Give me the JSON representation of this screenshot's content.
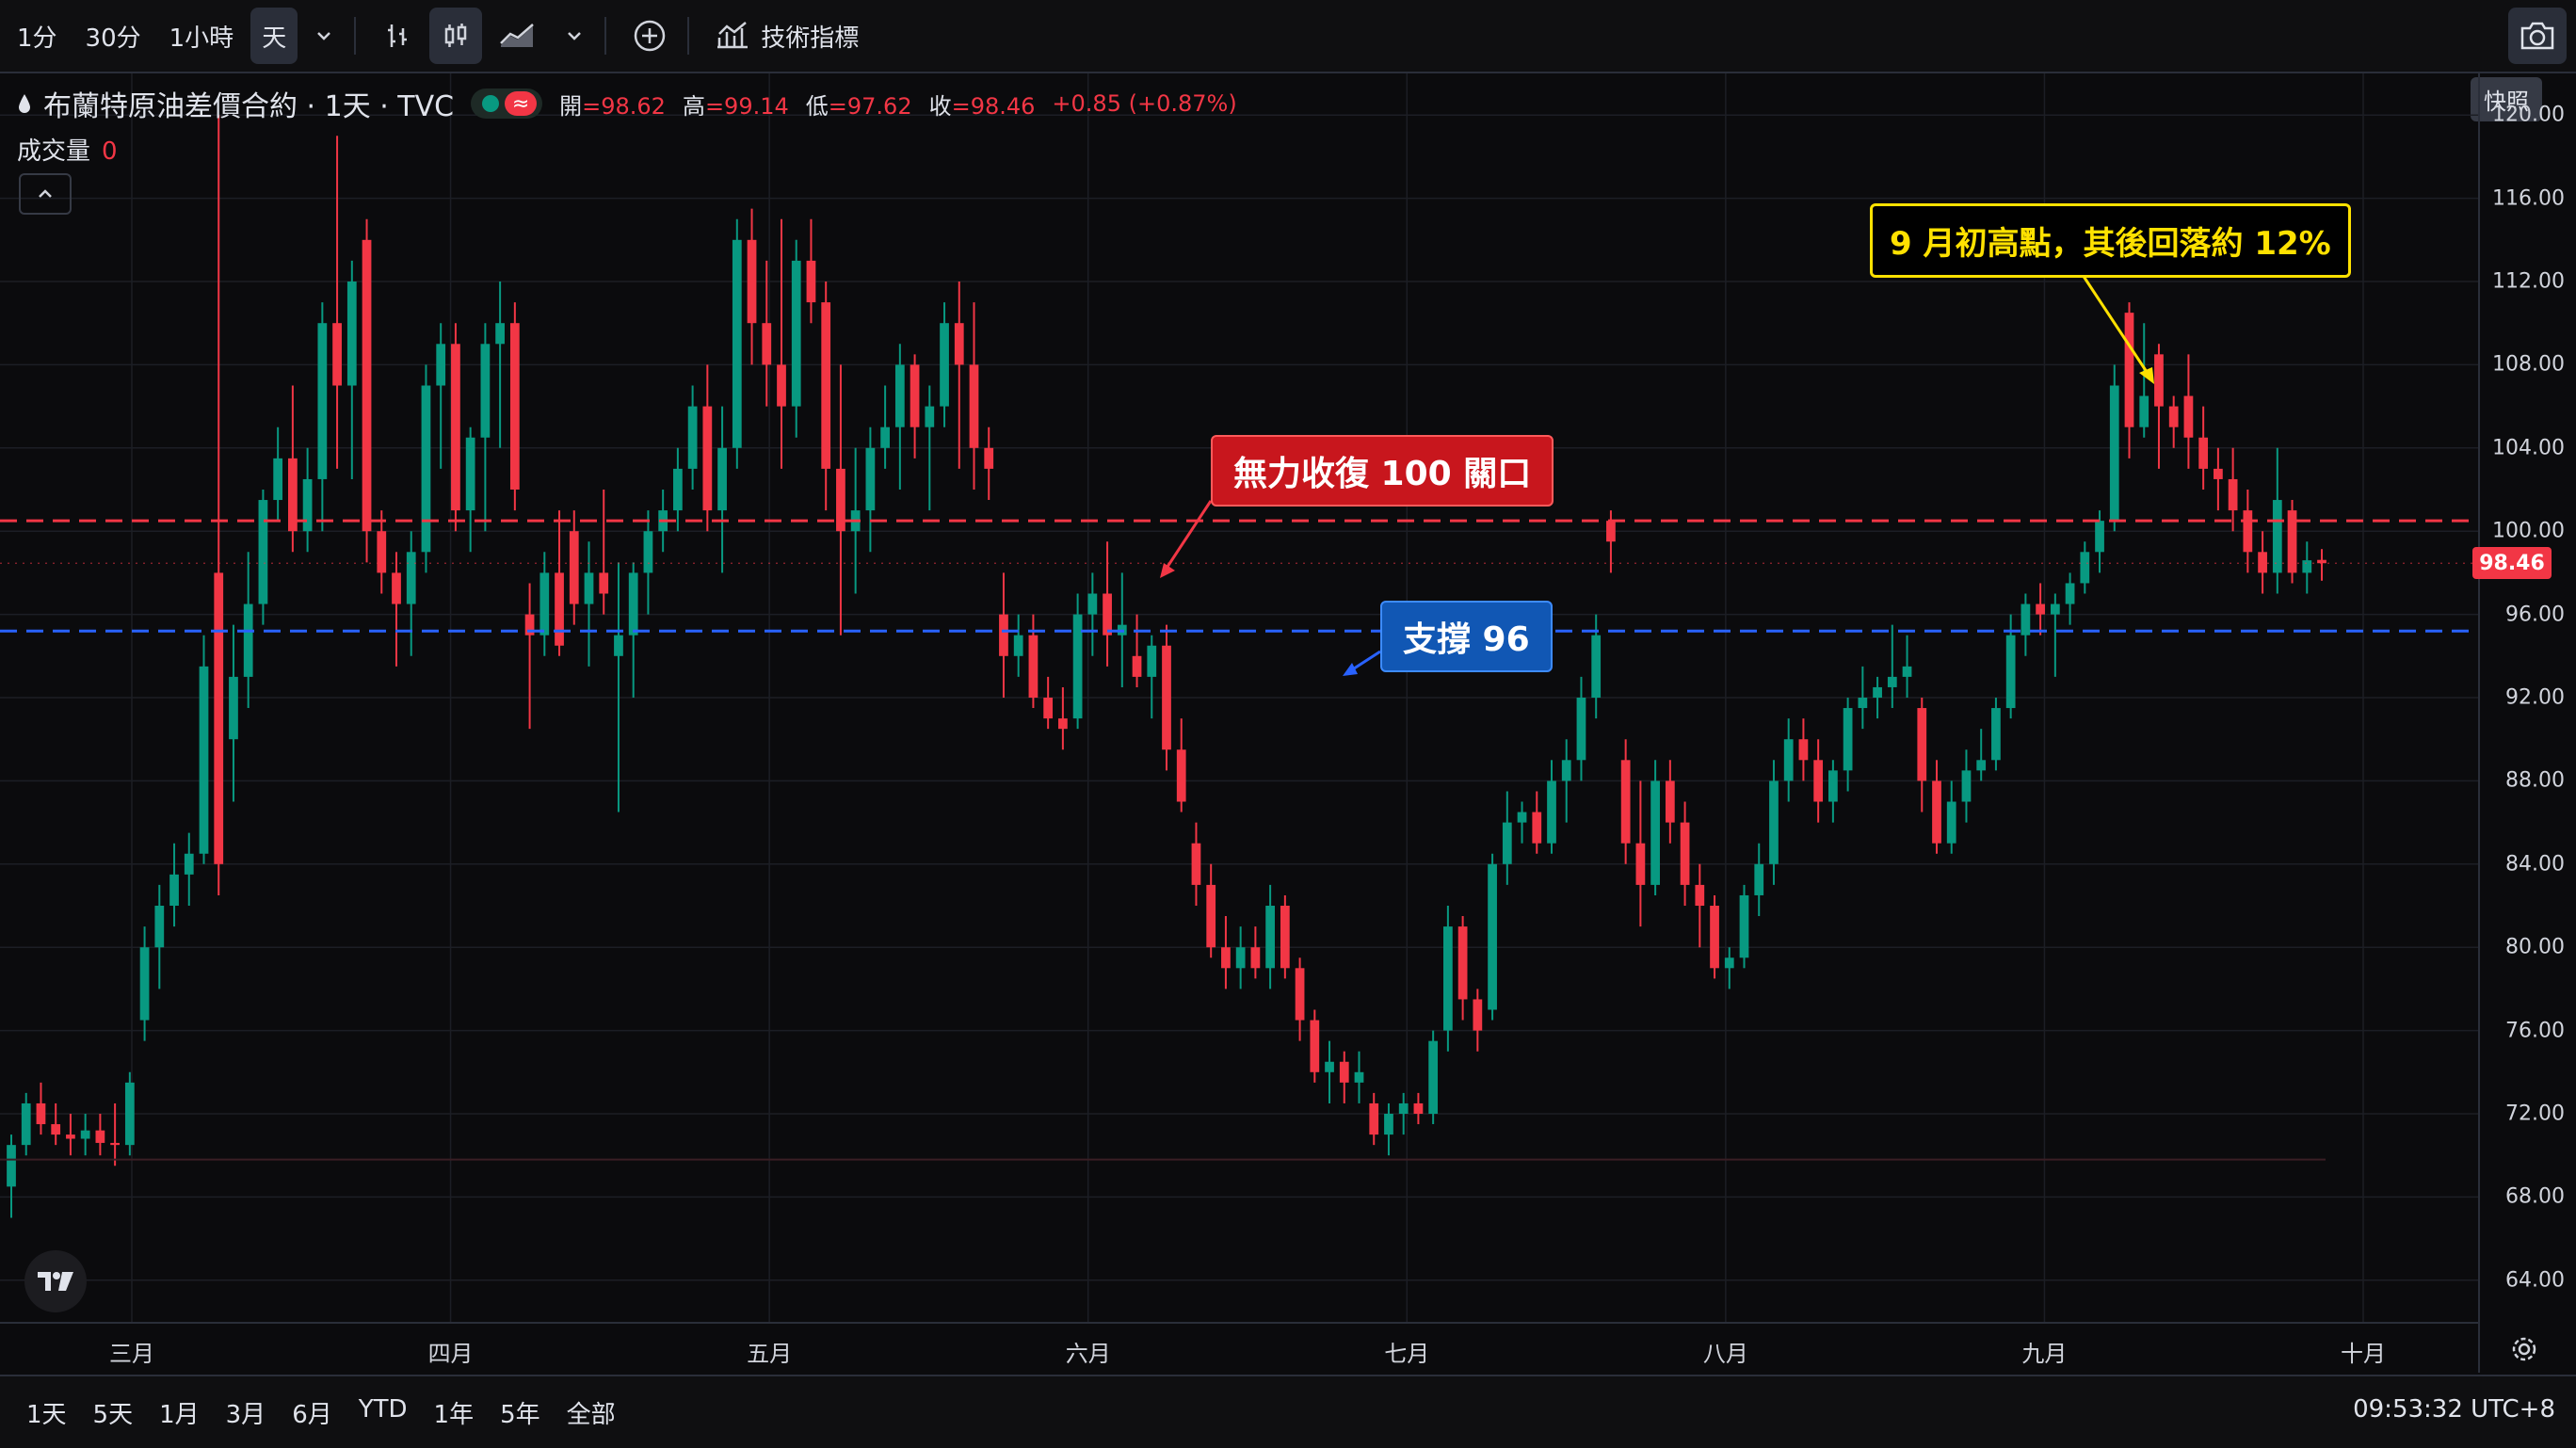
{
  "toolbar": {
    "intervals": [
      "1分",
      "30分",
      "1小時",
      "天"
    ],
    "indicators_label": "技術指標",
    "snapshot_tooltip": "快照"
  },
  "legend": {
    "symbol": "布蘭特原油差價合約 · 1天 · TVC",
    "open_key": "開",
    "open": "=98.62",
    "high_key": "高",
    "high": "=99.14",
    "low_key": "低",
    "low": "=97.62",
    "close_key": "收",
    "close": "=98.46",
    "change": "+0.85 (+0.87%)",
    "flag_symbol": "≈"
  },
  "volume": {
    "label": "成交量",
    "value": "0"
  },
  "price_axis": {
    "ticks": [
      "120.00",
      "116.00",
      "112.00",
      "108.00",
      "104.00",
      "100.00",
      "96.00",
      "92.00",
      "88.00",
      "84.00",
      "80.00",
      "76.00",
      "72.00",
      "68.00",
      "64.00"
    ],
    "last_price": "98.46"
  },
  "time_axis": {
    "months": [
      "三月",
      "四月",
      "五月",
      "六月",
      "七月",
      "八月",
      "九月",
      "十月"
    ]
  },
  "annotations": {
    "resistance": "無力收復 100 關口",
    "support": "支撐 96",
    "peak": "9 月初高點，其後回落約 12%"
  },
  "bottom": {
    "ranges": [
      "1天",
      "5天",
      "1月",
      "3月",
      "6月",
      "YTD",
      "1年",
      "5年",
      "全部"
    ],
    "clock": "09:53:32 UTC+8"
  },
  "colors": {
    "up": "#089981",
    "down": "#f23645",
    "resistance": "#f23645",
    "support": "#2962ff"
  },
  "chart_data": {
    "type": "candlestick",
    "title": "布蘭特原油差價合約 · 1天 · TVC",
    "ylim": [
      62,
      122
    ],
    "reference_lines": [
      {
        "name": "無力收復 100 關口",
        "value": 100.5
      },
      {
        "name": "支撐 96",
        "value": 95.2
      }
    ],
    "months": [
      "三月",
      "四月",
      "五月",
      "六月",
      "七月",
      "八月",
      "九月",
      "十月"
    ],
    "ohlc": [
      [
        68.5,
        71.0,
        67.0,
        70.5
      ],
      [
        70.5,
        73.0,
        70.0,
        72.5
      ],
      [
        72.5,
        73.5,
        71.0,
        71.5
      ],
      [
        71.5,
        72.5,
        70.5,
        71.0
      ],
      [
        71.0,
        72.0,
        70.0,
        70.8
      ],
      [
        70.8,
        72.0,
        70.0,
        71.2
      ],
      [
        71.2,
        72.0,
        70.0,
        70.6
      ],
      [
        70.6,
        72.5,
        69.5,
        70.5
      ],
      [
        70.5,
        74.0,
        70.0,
        73.5
      ],
      [
        76.5,
        81.0,
        75.5,
        80.0
      ],
      [
        80.0,
        83.0,
        78.0,
        82.0
      ],
      [
        82.0,
        85.0,
        81.0,
        83.5
      ],
      [
        83.5,
        85.5,
        82.0,
        84.5
      ],
      [
        84.5,
        95.0,
        84.0,
        93.5
      ],
      [
        98.0,
        120.0,
        82.5,
        84.0
      ],
      [
        90.0,
        95.5,
        87.0,
        93.0
      ],
      [
        93.0,
        99.0,
        91.5,
        96.5
      ],
      [
        96.5,
        102.0,
        95.5,
        101.5
      ],
      [
        101.5,
        105.0,
        100.5,
        103.5
      ],
      [
        103.5,
        107.0,
        99.0,
        100.0
      ],
      [
        100.0,
        104.0,
        99.0,
        102.5
      ],
      [
        102.5,
        111.0,
        100.0,
        110.0
      ],
      [
        110.0,
        119.0,
        103.0,
        107.0
      ],
      [
        107.0,
        113.0,
        102.5,
        112.0
      ],
      [
        114.0,
        115.0,
        98.5,
        100.0
      ],
      [
        100.0,
        101.0,
        97.0,
        98.0
      ],
      [
        98.0,
        99.0,
        93.5,
        96.5
      ],
      [
        96.5,
        100.0,
        94.0,
        99.0
      ],
      [
        99.0,
        108.0,
        98.0,
        107.0
      ],
      [
        107.0,
        110.0,
        103.0,
        109.0
      ],
      [
        109.0,
        110.0,
        100.0,
        101.0
      ],
      [
        101.0,
        105.0,
        99.0,
        104.5
      ],
      [
        104.5,
        110.0,
        100.0,
        109.0
      ],
      [
        109.0,
        112.0,
        104.0,
        110.0
      ],
      [
        110.0,
        111.0,
        101.0,
        102.0
      ],
      [
        96.0,
        97.5,
        90.5,
        95.0
      ],
      [
        95.0,
        99.0,
        94.0,
        98.0
      ],
      [
        98.0,
        101.0,
        94.0,
        94.5
      ],
      [
        100.0,
        101.0,
        95.5,
        96.5
      ],
      [
        96.5,
        99.5,
        93.5,
        98.0
      ],
      [
        98.0,
        102.0,
        96.0,
        97.0
      ],
      [
        94.0,
        98.5,
        86.5,
        95.0
      ],
      [
        95.0,
        98.5,
        92.0,
        98.0
      ],
      [
        98.0,
        101.0,
        96.0,
        100.0
      ],
      [
        100.0,
        102.0,
        99.0,
        101.0
      ],
      [
        101.0,
        104.0,
        100.0,
        103.0
      ],
      [
        103.0,
        107.0,
        102.0,
        106.0
      ],
      [
        106.0,
        108.0,
        100.0,
        101.0
      ],
      [
        101.0,
        106.0,
        98.0,
        104.0
      ],
      [
        104.0,
        115.0,
        103.0,
        114.0
      ],
      [
        114.0,
        115.5,
        108.0,
        110.0
      ],
      [
        110.0,
        113.0,
        106.0,
        108.0
      ],
      [
        108.0,
        115.0,
        103.0,
        106.0
      ],
      [
        106.0,
        114.0,
        104.5,
        113.0
      ],
      [
        113.0,
        115.0,
        110.0,
        111.0
      ],
      [
        111.0,
        112.0,
        101.0,
        103.0
      ],
      [
        103.0,
        108.0,
        95.0,
        100.0
      ],
      [
        100.0,
        104.0,
        97.0,
        101.0
      ],
      [
        101.0,
        105.0,
        99.0,
        104.0
      ],
      [
        104.0,
        107.0,
        103.0,
        105.0
      ],
      [
        105.0,
        109.0,
        102.0,
        108.0
      ],
      [
        108.0,
        108.5,
        103.5,
        105.0
      ],
      [
        105.0,
        107.0,
        101.0,
        106.0
      ],
      [
        106.0,
        111.0,
        105.0,
        110.0
      ],
      [
        110.0,
        112.0,
        103.0,
        108.0
      ],
      [
        108.0,
        111.0,
        102.0,
        104.0
      ],
      [
        104.0,
        105.0,
        101.5,
        103.0
      ],
      [
        96.0,
        98.0,
        92.0,
        94.0
      ],
      [
        94.0,
        96.0,
        93.0,
        95.0
      ],
      [
        95.0,
        96.0,
        91.5,
        92.0
      ],
      [
        92.0,
        93.0,
        90.5,
        91.0
      ],
      [
        91.0,
        92.5,
        89.5,
        90.5
      ],
      [
        91.0,
        97.0,
        90.5,
        96.0
      ],
      [
        96.0,
        98.0,
        94.0,
        97.0
      ],
      [
        97.0,
        99.5,
        93.5,
        95.0
      ],
      [
        95.0,
        98.0,
        92.5,
        95.5
      ],
      [
        94.0,
        96.0,
        92.5,
        93.0
      ],
      [
        93.0,
        95.0,
        91.0,
        94.5
      ],
      [
        94.5,
        95.5,
        88.5,
        89.5
      ],
      [
        89.5,
        91.0,
        86.5,
        87.0
      ],
      [
        85.0,
        86.0,
        82.0,
        83.0
      ],
      [
        83.0,
        84.0,
        79.5,
        80.0
      ],
      [
        80.0,
        81.5,
        78.0,
        79.0
      ],
      [
        79.0,
        81.0,
        78.0,
        80.0
      ],
      [
        80.0,
        81.0,
        78.5,
        79.0
      ],
      [
        79.0,
        83.0,
        78.0,
        82.0
      ],
      [
        82.0,
        82.5,
        78.5,
        79.0
      ],
      [
        79.0,
        79.5,
        75.5,
        76.5
      ],
      [
        76.5,
        77.0,
        73.5,
        74.0
      ],
      [
        74.0,
        75.5,
        72.5,
        74.5
      ],
      [
        74.5,
        75.0,
        72.5,
        73.5
      ],
      [
        73.5,
        75.0,
        72.5,
        74.0
      ],
      [
        72.5,
        73.0,
        70.5,
        71.0
      ],
      [
        71.0,
        72.5,
        70.0,
        72.0
      ],
      [
        72.0,
        73.0,
        71.0,
        72.5
      ],
      [
        72.5,
        73.0,
        71.5,
        72.0
      ],
      [
        72.0,
        76.0,
        71.5,
        75.5
      ],
      [
        76.0,
        82.0,
        75.0,
        81.0
      ],
      [
        81.0,
        81.5,
        76.5,
        77.5
      ],
      [
        77.5,
        78.0,
        75.0,
        76.0
      ],
      [
        77.0,
        84.5,
        76.5,
        84.0
      ],
      [
        84.0,
        87.5,
        83.0,
        86.0
      ],
      [
        86.0,
        87.0,
        85.0,
        86.5
      ],
      [
        86.5,
        87.5,
        84.5,
        85.0
      ],
      [
        85.0,
        89.0,
        84.5,
        88.0
      ],
      [
        88.0,
        90.0,
        86.0,
        89.0
      ],
      [
        89.0,
        93.0,
        88.0,
        92.0
      ],
      [
        92.0,
        96.0,
        91.0,
        95.0
      ],
      [
        100.5,
        101.0,
        98.0,
        99.5
      ],
      [
        89.0,
        90.0,
        84.0,
        85.0
      ],
      [
        85.0,
        88.0,
        81.0,
        83.0
      ],
      [
        83.0,
        89.0,
        82.5,
        88.0
      ],
      [
        88.0,
        89.0,
        85.0,
        86.0
      ],
      [
        86.0,
        87.0,
        82.0,
        83.0
      ],
      [
        83.0,
        84.0,
        80.0,
        82.0
      ],
      [
        82.0,
        82.5,
        78.5,
        79.0
      ],
      [
        79.0,
        80.0,
        78.0,
        79.5
      ],
      [
        79.5,
        83.0,
        79.0,
        82.5
      ],
      [
        82.5,
        85.0,
        81.5,
        84.0
      ],
      [
        84.0,
        89.0,
        83.0,
        88.0
      ],
      [
        88.0,
        91.0,
        87.0,
        90.0
      ],
      [
        90.0,
        91.0,
        88.0,
        89.0
      ],
      [
        89.0,
        90.0,
        86.0,
        87.0
      ],
      [
        87.0,
        89.0,
        86.0,
        88.5
      ],
      [
        88.5,
        92.0,
        87.5,
        91.5
      ],
      [
        91.5,
        93.5,
        90.5,
        92.0
      ],
      [
        92.0,
        93.0,
        91.0,
        92.5
      ],
      [
        92.5,
        95.5,
        91.5,
        93.0
      ],
      [
        93.0,
        95.0,
        92.0,
        93.5
      ],
      [
        91.5,
        92.0,
        86.5,
        88.0
      ],
      [
        88.0,
        89.0,
        84.5,
        85.0
      ],
      [
        85.0,
        88.0,
        84.5,
        87.0
      ],
      [
        87.0,
        89.5,
        86.0,
        88.5
      ],
      [
        88.5,
        90.5,
        88.0,
        89.0
      ],
      [
        89.0,
        92.0,
        88.5,
        91.5
      ],
      [
        91.5,
        96.0,
        91.0,
        95.0
      ],
      [
        95.0,
        97.0,
        94.0,
        96.5
      ],
      [
        96.5,
        97.5,
        95.0,
        96.0
      ],
      [
        96.0,
        97.0,
        93.0,
        96.5
      ],
      [
        96.5,
        98.0,
        95.5,
        97.5
      ],
      [
        97.5,
        99.5,
        97.0,
        99.0
      ],
      [
        99.0,
        101.0,
        98.0,
        100.5
      ],
      [
        100.5,
        108.0,
        100.0,
        107.0
      ],
      [
        110.5,
        111.0,
        103.5,
        105.0
      ],
      [
        105.0,
        110.0,
        104.5,
        106.5
      ],
      [
        108.5,
        109.0,
        103.0,
        106.0
      ],
      [
        106.0,
        106.5,
        104.0,
        105.0
      ],
      [
        106.5,
        108.5,
        103.0,
        104.5
      ],
      [
        104.5,
        106.0,
        102.0,
        103.0
      ],
      [
        103.0,
        104.0,
        101.0,
        102.5
      ],
      [
        102.5,
        104.0,
        100.0,
        101.0
      ],
      [
        101.0,
        102.0,
        98.0,
        99.0
      ],
      [
        99.0,
        100.0,
        97.0,
        98.0
      ],
      [
        98.0,
        104.0,
        97.0,
        101.5
      ],
      [
        101.0,
        101.5,
        97.5,
        98.0
      ],
      [
        98.0,
        99.5,
        97.0,
        98.6
      ],
      [
        98.62,
        99.14,
        97.62,
        98.46
      ]
    ]
  }
}
